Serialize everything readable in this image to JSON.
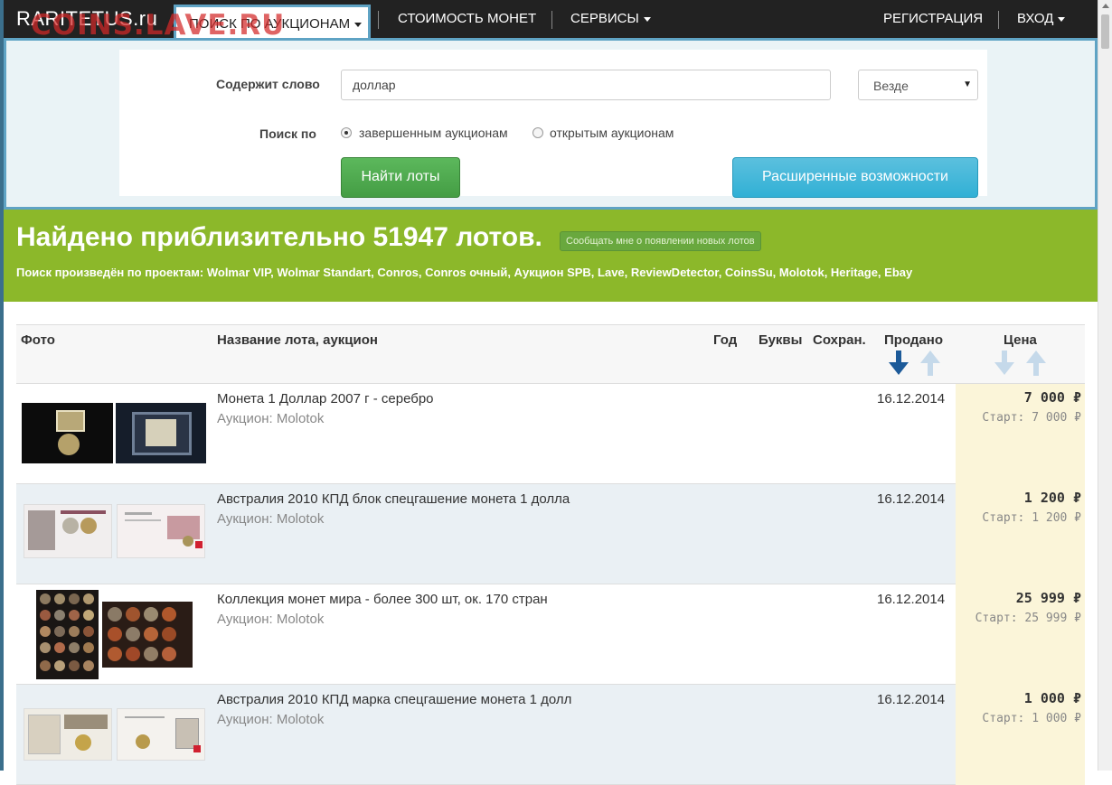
{
  "navbar": {
    "brand": "RARITETUS.ru",
    "watermark": "COINS.LAVE.RU",
    "active_tab": "ПОИСК ПО АУКЦИОНАМ",
    "items": {
      "prices": "СТОИМОСТЬ МОНЕТ",
      "services": "СЕРВИСЫ",
      "register": "РЕГИСТРАЦИЯ",
      "login": "ВХОД"
    }
  },
  "search": {
    "word_label": "Содержит слово",
    "word_value": "доллар",
    "scope_value": "Везде",
    "search_by_label": "Поиск по",
    "radio_completed": "завершенным аукционам",
    "radio_open": "открытым аукционам",
    "find_button": "Найти лоты",
    "advanced_button": "Расширенные возможности"
  },
  "banner": {
    "title": "Найдено приблизительно 51947 лотов.",
    "notify": "Сообщать мне о появлении новых лотов",
    "projects": "Поиск произведён по проектам: Wolmar VIP, Wolmar Standart, Conros, Conros очный, Аукцион SPB, Lave, ReviewDetector, CoinsSu, Molotok, Heritage, Ebay"
  },
  "table": {
    "headers": {
      "photo": "Фото",
      "name": "Название лота, аукцион",
      "year": "Год",
      "letters": "Буквы",
      "condition": "Сохран.",
      "sold": "Продано",
      "price": "Цена"
    },
    "rows": [
      {
        "title": "Монета 1 Доллар 2007 г - серебро",
        "auction": "Аукцион: Molotok",
        "date": "16.12.2014",
        "price": "7 000 ₽",
        "start": "Старт: 7 000 ₽"
      },
      {
        "title": "Австралия 2010 КПД блок спецгашение монета 1 долла",
        "auction": "Аукцион: Molotok",
        "date": "16.12.2014",
        "price": "1 200 ₽",
        "start": "Старт: 1 200 ₽"
      },
      {
        "title": "Коллекция монет мира - более 300 шт, ок. 170 стран",
        "auction": "Аукцион: Molotok",
        "date": "16.12.2014",
        "price": "25 999 ₽",
        "start": "Старт: 25 999 ₽"
      },
      {
        "title": "Австралия 2010 КПД марка спецгашение монета 1 долл",
        "auction": "Аукцион: Molotok",
        "date": "16.12.2014",
        "price": "1 000 ₽",
        "start": "Старт: 1 000 ₽"
      }
    ]
  },
  "colors": {
    "navbar": "#222222",
    "banner": "#8cb82a",
    "find_button": "#5cb85c",
    "advanced_button": "#5bc0de",
    "price_cell": "#fbf5d9",
    "sort_active": "#1c5a99",
    "sort_inactive": "#c5d9ea"
  }
}
